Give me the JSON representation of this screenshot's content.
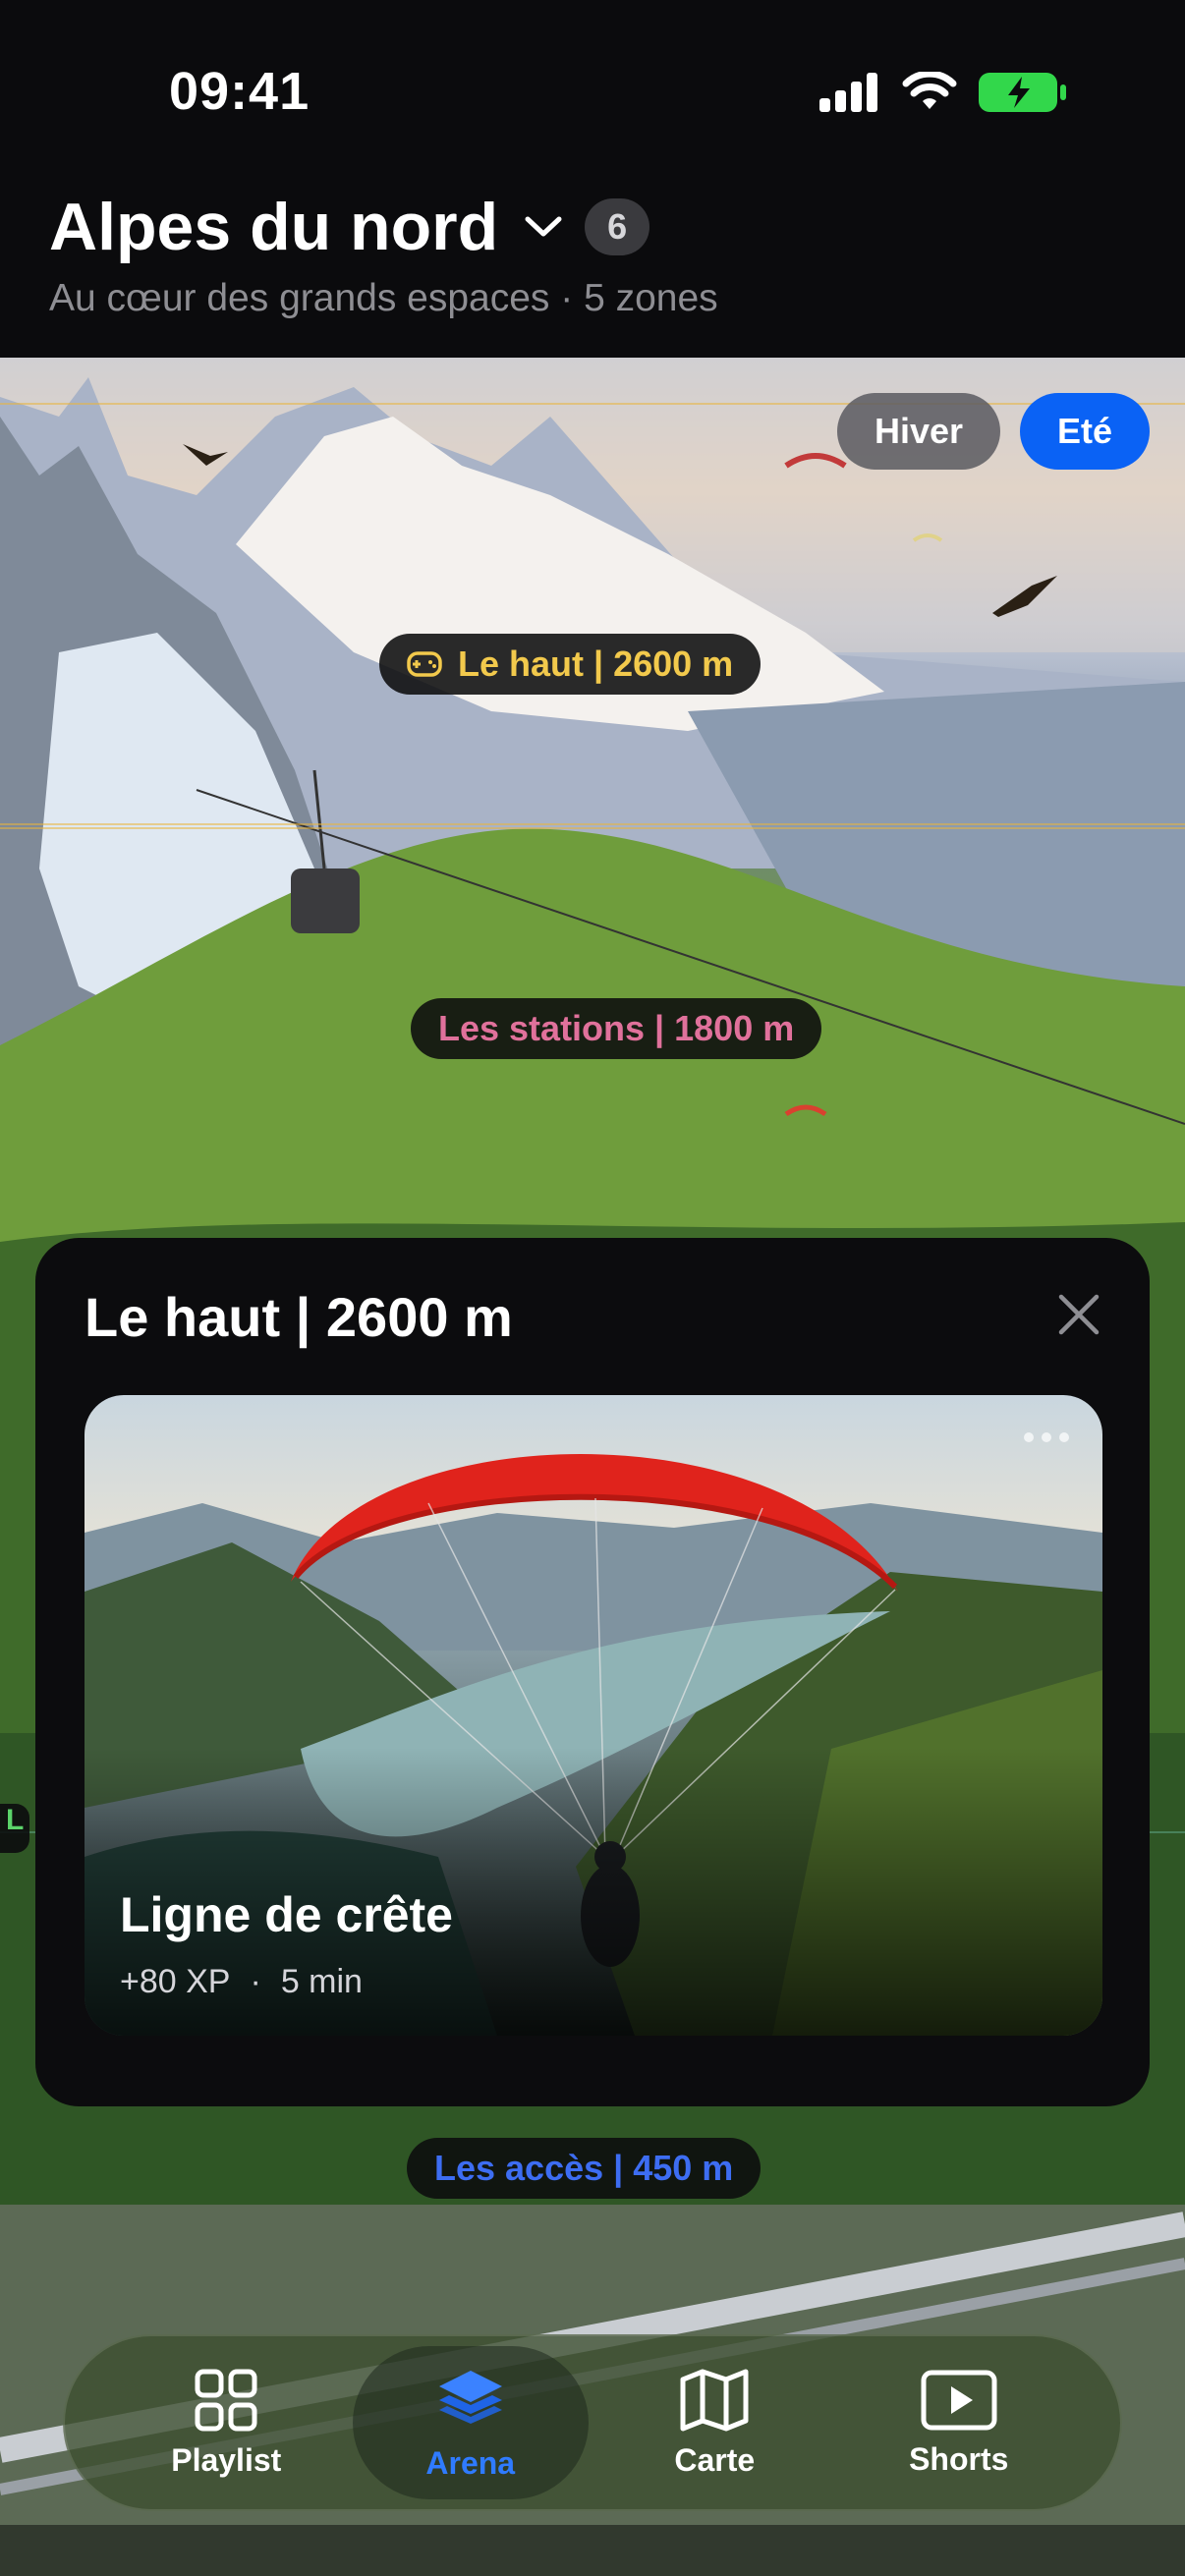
{
  "status_bar": {
    "time": "09:41"
  },
  "header": {
    "title": "Alpes du nord",
    "count": "6",
    "subtitle": "Au cœur des grands espaces · 5 zones"
  },
  "season_toggle": {
    "winter": "Hiver",
    "summer": "Eté",
    "selected": "Eté"
  },
  "zones": {
    "top": "Le haut | 2600 m",
    "stations": "Les stations | 1800 m",
    "access": "Les accès | 450 m",
    "side_tab": "L"
  },
  "detail_sheet": {
    "title": "Le haut | 2600 m",
    "card": {
      "title": "Ligne de crête",
      "xp": "+80 XP",
      "separator": "·",
      "duration": "5 min"
    }
  },
  "tab_bar": {
    "tabs": [
      {
        "label": "Playlist",
        "icon": "grid-icon"
      },
      {
        "label": "Arena",
        "icon": "layers-icon"
      },
      {
        "label": "Carte",
        "icon": "map-icon"
      },
      {
        "label": "Shorts",
        "icon": "play-icon"
      }
    ],
    "active": "Arena"
  },
  "colors": {
    "accent_blue": "#0a62f5",
    "zone_top": "#f2c94c",
    "zone_stations": "#e0719b",
    "zone_access": "#3d6df2",
    "battery_green": "#32d74b"
  }
}
